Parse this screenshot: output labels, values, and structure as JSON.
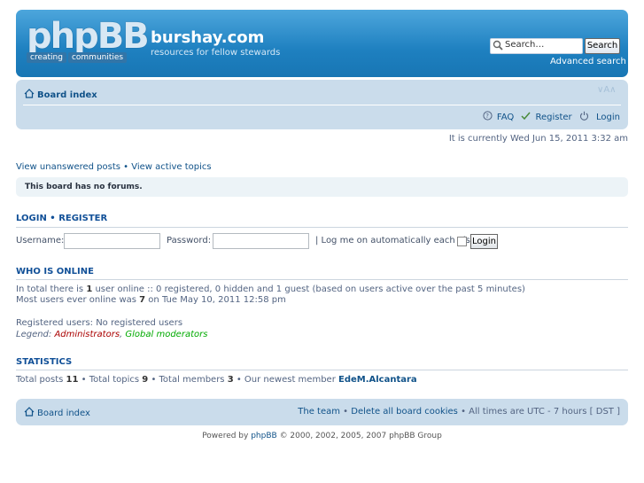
{
  "header": {
    "logo_word": "phpBB",
    "logo_tag_1": "creating",
    "logo_tag_2": "communities",
    "site_title": "burshay.com",
    "site_description": "resources for fellow stewards",
    "search_placeholder": "Search…",
    "search_button": "Search",
    "advanced_search": "Advanced search"
  },
  "navbar": {
    "board_index": "Board index",
    "font_size_control": "∨A∧",
    "faq": "FAQ",
    "register": "Register",
    "login": "Login"
  },
  "status": {
    "current_time": "It is currently Wed Jun 15, 2011 3:32 am"
  },
  "search_links": {
    "unanswered": "View unanswered posts",
    "separator": " • ",
    "active": "View active topics"
  },
  "notice": {
    "no_forums": "This board has no forums."
  },
  "login": {
    "title_login": "Login",
    "title_sep": " • ",
    "title_register": "Register",
    "username_label": "Username:",
    "username_value": "",
    "password_label": "Password:",
    "password_value": "",
    "autologin_label": "| Log me on automatically each visit",
    "autologin_checked": false,
    "button": "Login"
  },
  "online": {
    "title": "Who is online",
    "line1_a": "In total there is ",
    "line1_count": "1",
    "line1_b": " user online :: 0 registered, 0 hidden and 1 guest (based on users active over the past 5 minutes)",
    "line2_a": "Most users ever online was ",
    "line2_count": "7",
    "line2_b": " on Tue May 10, 2011 12:58 pm",
    "registered": "Registered users: No registered users",
    "legend_label": "Legend: ",
    "legend_admin": "Administrators",
    "legend_sep": ", ",
    "legend_gmod": "Global moderators"
  },
  "statistics": {
    "title": "Statistics",
    "posts_label": "Total posts ",
    "posts": "11",
    "topics_label": " • Total topics ",
    "topics": "9",
    "members_label": " • Total members ",
    "members": "3",
    "newest_label": " • Our newest member ",
    "newest_member": "EdeM.Alcantara"
  },
  "footer": {
    "board_index": "Board index",
    "team": "The team",
    "sep": " • ",
    "delete_cookies": "Delete all board cookies",
    "timezone": " • All times are UTC - 7 hours [ DST ]"
  },
  "copyright": {
    "prefix": "Powered by ",
    "link": "phpBB",
    "suffix": " © 2000, 2002, 2005, 2007 phpBB Group"
  },
  "colors": {
    "header_blue": "#1e80c0",
    "nav_blue": "#cadceb",
    "link": "#105289",
    "admin": "#AA0000",
    "global_mod": "#00AA00"
  }
}
